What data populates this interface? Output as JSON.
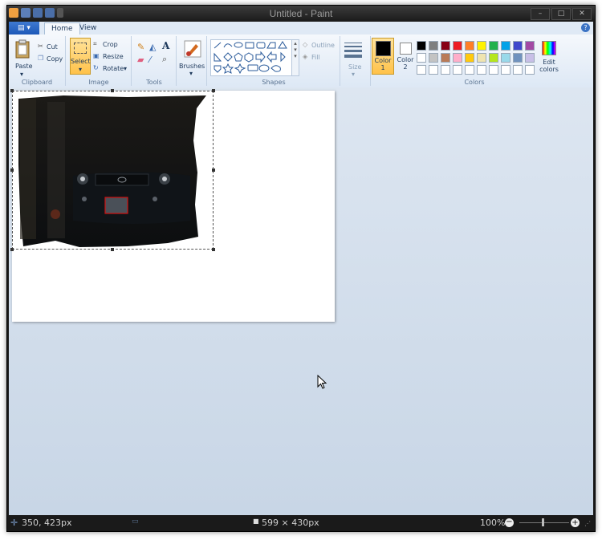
{
  "window": {
    "title": "Untitled - Paint"
  },
  "tabs": [
    "Home",
    "View"
  ],
  "ribbon": {
    "clipboard": {
      "paste": "Paste",
      "cut": "Cut",
      "copy": "Copy",
      "label": "Clipboard"
    },
    "image": {
      "select": "Select",
      "crop": "Crop",
      "resize": "Resize",
      "rotate": "Rotate",
      "label": "Image"
    },
    "tools": {
      "label": "Tools"
    },
    "brushes": {
      "label": "Brushes"
    },
    "shapes": {
      "outline": "Outline",
      "fill": "Fill",
      "label": "Shapes"
    },
    "size": {
      "label": "Size"
    },
    "colors": {
      "color1": "Color 1",
      "color2": "Color 2",
      "edit": "Edit colors",
      "label": "Colors",
      "palette_row1": [
        "#000000",
        "#7f7f7f",
        "#880015",
        "#ed1c24",
        "#ff7f27",
        "#fff200",
        "#22b14c",
        "#00a2e8",
        "#3f48cc",
        "#a349a4"
      ],
      "palette_row2": [
        "#ffffff",
        "#c3c3c3",
        "#b97a57",
        "#ffaec9",
        "#ffc90e",
        "#efe4b0",
        "#b5e61d",
        "#99d9ea",
        "#7092be",
        "#c8bfe7"
      ]
    }
  },
  "status": {
    "cursor_pos": "350, 423px",
    "image_size": "599 × 430px",
    "zoom": "100%"
  }
}
